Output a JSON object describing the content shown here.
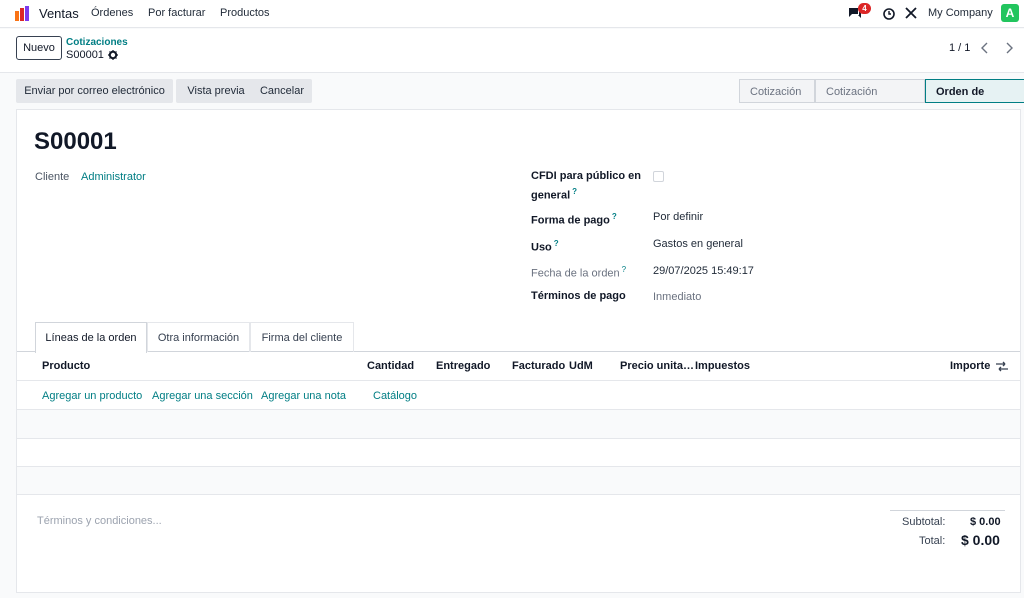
{
  "navbar": {
    "app_name": "Ventas",
    "menu": [
      "Órdenes",
      "Por facturar",
      "Productos"
    ],
    "chat_count": "4",
    "company": "My Company",
    "avatar_letter": "A"
  },
  "control": {
    "new_label": "Nuevo",
    "breadcrumb_parent": "Cotizaciones",
    "breadcrumb_current": "S00001",
    "pager": "1 / 1"
  },
  "actions": {
    "email": "Enviar por correo electrónico",
    "preview": "Vista previa",
    "cancel": "Cancelar"
  },
  "status": {
    "stages": [
      "Cotización",
      "Cotización enviada",
      "Orden de venta"
    ],
    "active": "Orden de venta"
  },
  "form": {
    "name": "S00001",
    "cliente_label": "Cliente",
    "cliente_value": "Administrator",
    "cfdi_label_1": "CFDI para público en",
    "cfdi_label_2": "general",
    "forma_pago_label": "Forma de pago",
    "forma_pago_value": "Por definir",
    "uso_label": "Uso",
    "uso_value": "Gastos en general",
    "fecha_label": "Fecha de la orden",
    "fecha_value": "29/07/2025 15:49:17",
    "terminos_label": "Términos de pago",
    "terminos_value": "Inmediato",
    "help_mark": "?"
  },
  "tabs": [
    "Líneas de la orden",
    "Otra información",
    "Firma del cliente"
  ],
  "table": {
    "headers": {
      "producto": "Producto",
      "cantidad": "Cantidad",
      "entregado": "Entregado",
      "facturado": "Facturado",
      "udm": "UdM",
      "precio": "Precio unita…",
      "impuestos": "Impuestos",
      "importe": "Importe"
    },
    "add_links": {
      "producto": "Agregar un producto",
      "seccion": "Agregar una sección",
      "nota": "Agregar una nota",
      "catalogo": "Catálogo"
    }
  },
  "footer": {
    "terms_placeholder": "Términos y condiciones...",
    "subtotal_label": "Subtotal:",
    "subtotal_value": "$ 0.00",
    "total_label": "Total:",
    "total_value": "$ 0.00"
  },
  "colors": {
    "accent": "#017e84",
    "badge": "#dc2626",
    "avatar": "#22c55e"
  },
  "icons": [
    "ventas-app-icon",
    "chat-icon",
    "clock-icon",
    "tools-icon",
    "gear-icon",
    "chevron-left-icon",
    "chevron-right-icon",
    "column-settings-icon"
  ]
}
